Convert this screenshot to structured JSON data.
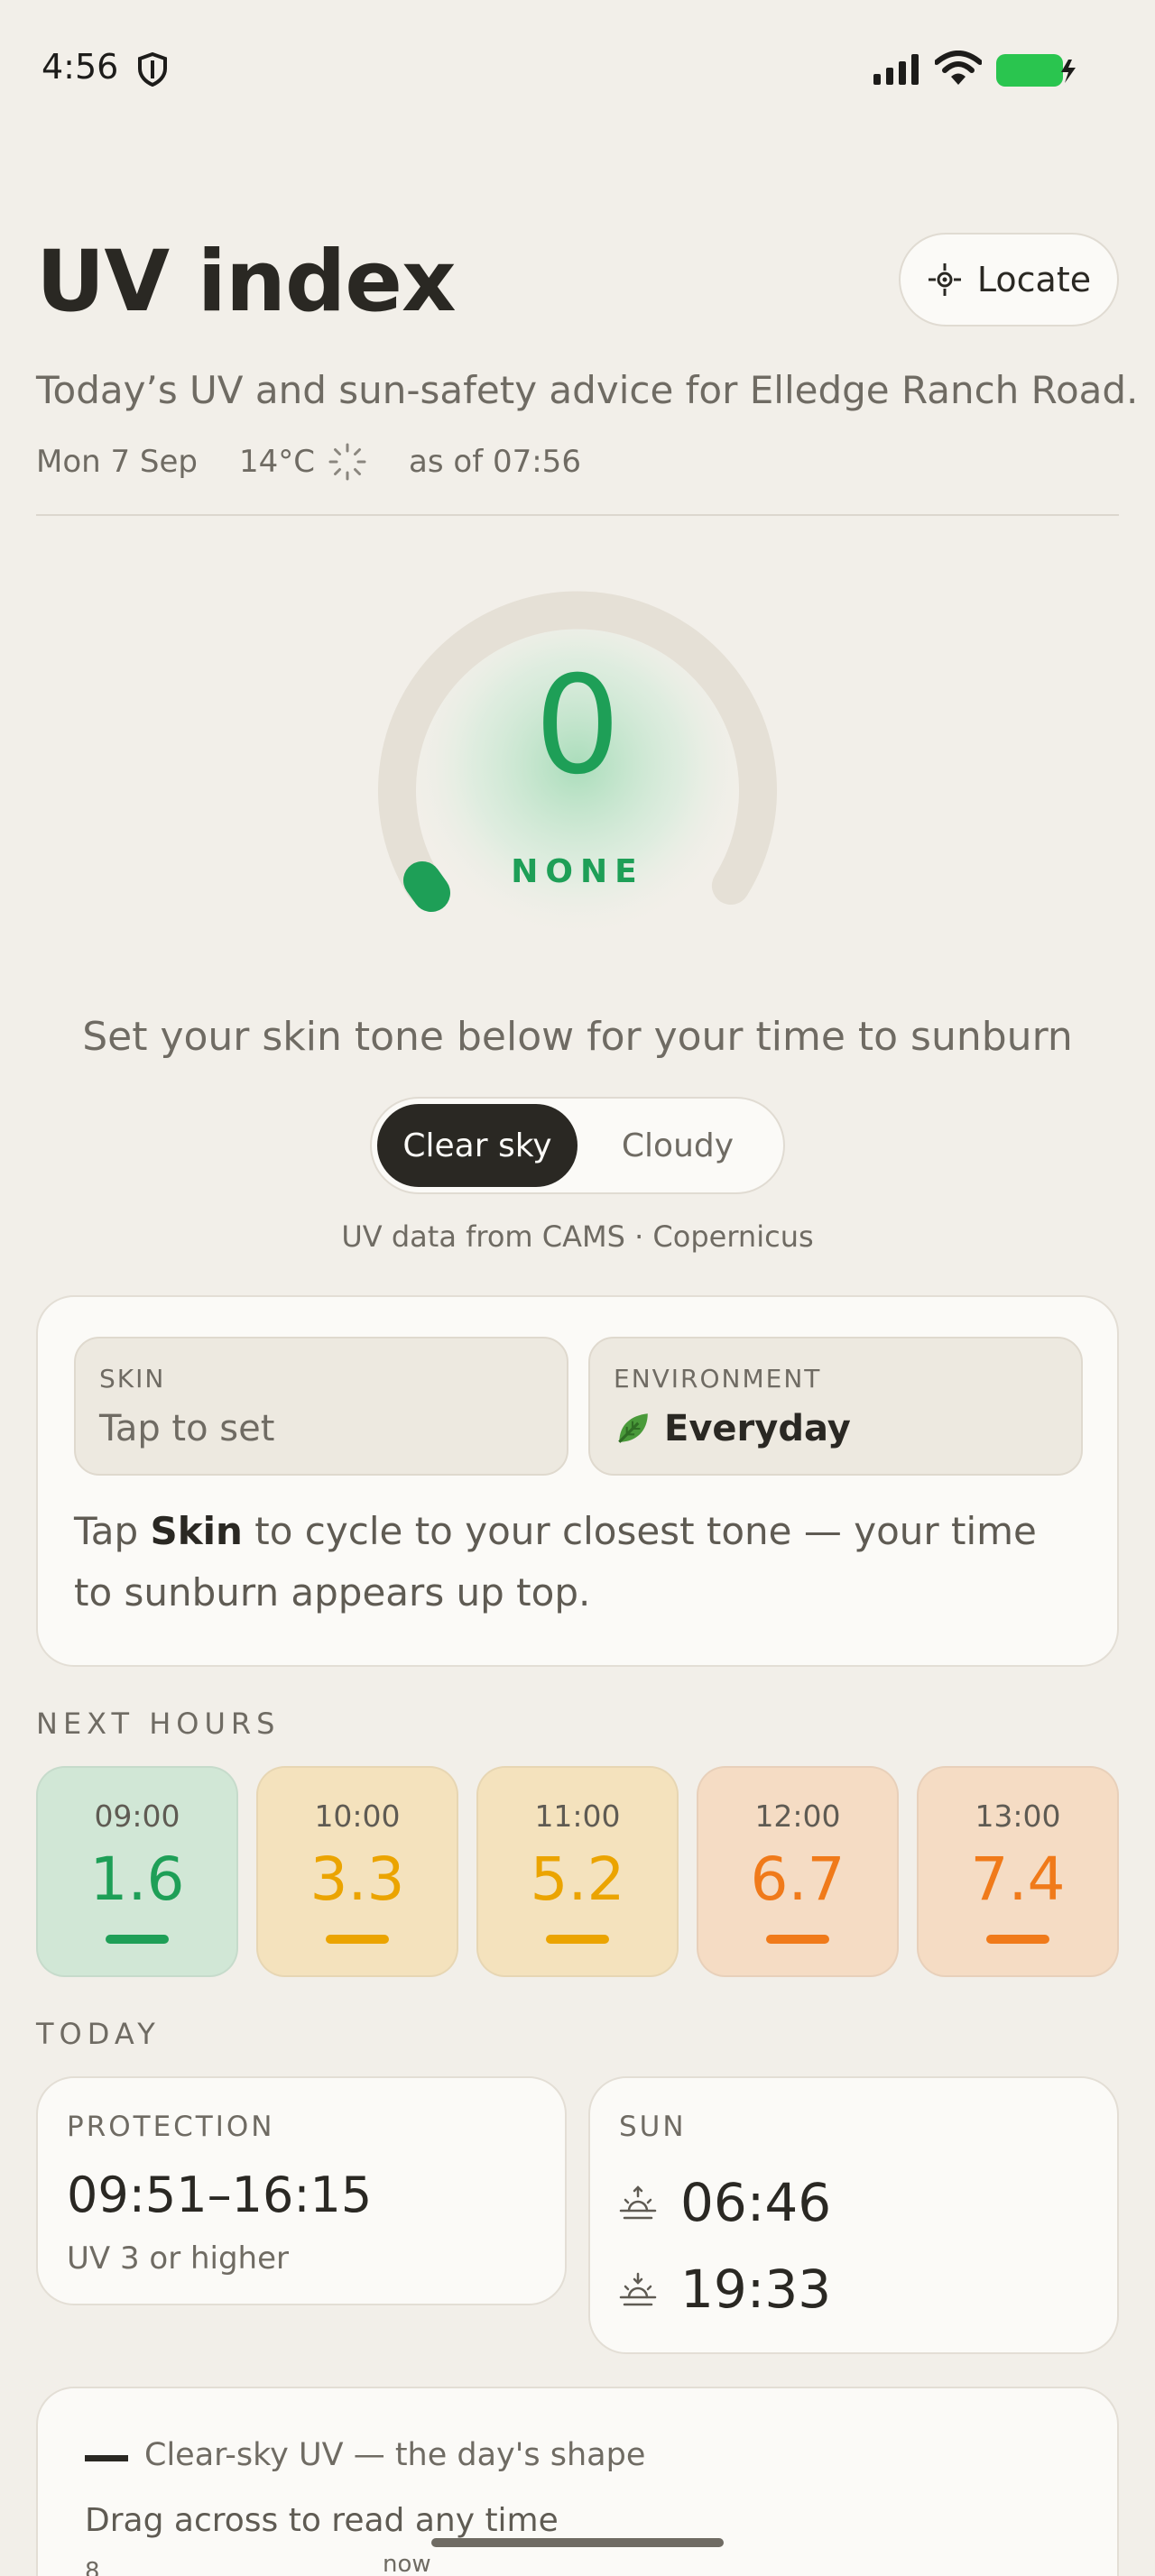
{
  "status_bar": {
    "time": "4:56",
    "icons": [
      "shield-icon",
      "signal-icon",
      "wifi-icon",
      "battery-charging-icon"
    ]
  },
  "header": {
    "title": "UV index",
    "locate_label": "Locate",
    "locate_icon": "crosshair-icon",
    "subtitle": "Today’s UV and sun-safety advice for Elledge Ranch Road.",
    "date": "Mon 7 Sep",
    "temperature": "14°C",
    "loading_icon": "spinner-icon",
    "as_of": "as of 07:56"
  },
  "gauge": {
    "value": "0",
    "level": "NONE",
    "uv_fraction": 0.0,
    "color": "#1e9f57"
  },
  "hint": "Set your skin tone below for your time to sunburn",
  "sky_toggle": {
    "options": [
      "Clear sky",
      "Cloudy"
    ],
    "selected": "Clear sky"
  },
  "source": "UV data from CAMS · Copernicus",
  "settings": {
    "skin_label": "SKIN",
    "skin_value": "Tap to set",
    "environment_label": "ENVIRONMENT",
    "environment_icon": "leaf-icon",
    "environment_value": "Everyday",
    "help_prefix": "Tap ",
    "help_bold": "Skin",
    "help_suffix": " to cycle to your closest tone — your time to sunburn appears up top."
  },
  "next_hours": {
    "label": "NEXT HOURS",
    "items": [
      {
        "time": "09:00",
        "uv": "1.6",
        "color": "#1e9f57",
        "bg": "#d1e7d6"
      },
      {
        "time": "10:00",
        "uv": "3.3",
        "color": "#eba400",
        "bg": "#f4e2bd"
      },
      {
        "time": "11:00",
        "uv": "5.2",
        "color": "#eba400",
        "bg": "#f4e2bd"
      },
      {
        "time": "12:00",
        "uv": "6.7",
        "color": "#f07a1a",
        "bg": "#f5dcc4"
      },
      {
        "time": "13:00",
        "uv": "7.4",
        "color": "#f07a1a",
        "bg": "#f5dcc4"
      }
    ]
  },
  "today": {
    "label": "TODAY",
    "protection_label": "PROTECTION",
    "protection_window": "09:51–16:15",
    "protection_note": "UV 3 or higher",
    "sun_label": "SUN",
    "sunrise": "06:46",
    "sunset": "19:33",
    "sunrise_icon": "sunrise-icon",
    "sunset_icon": "sunset-icon"
  },
  "chart_card": {
    "legend": "Clear-sky UV — the day's shape",
    "hint": "Drag across to read any time",
    "axis_peek": "8",
    "now_label": "now"
  }
}
